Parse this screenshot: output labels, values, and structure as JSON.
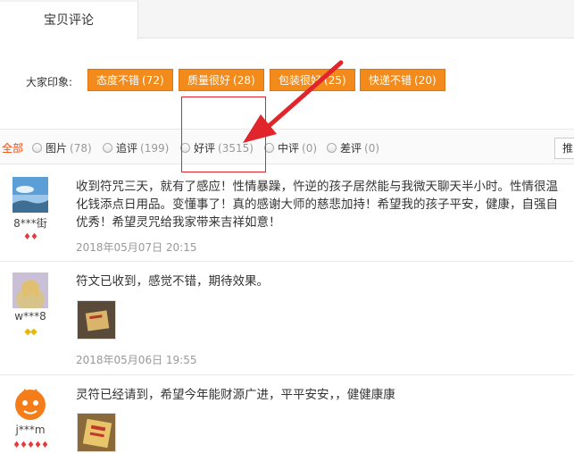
{
  "tabs": {
    "active_label": "宝贝评论"
  },
  "impressions": {
    "label": "大家印象:",
    "tags": [
      {
        "text": "态度不错",
        "count": "(72)"
      },
      {
        "text": "质量很好",
        "count": "(28)"
      },
      {
        "text": "包装很好",
        "count": "(25)"
      },
      {
        "text": "快递不错",
        "count": "(20)"
      }
    ]
  },
  "filters": {
    "all": "全部",
    "items": [
      {
        "label": "图片",
        "count": "(78)"
      },
      {
        "label": "追评",
        "count": "(199)"
      },
      {
        "label": "好评",
        "count": "(3515)"
      },
      {
        "label": "中评",
        "count": "(0)"
      },
      {
        "label": "差评",
        "count": "(0)"
      }
    ],
    "sort_label": "推"
  },
  "reviews": [
    {
      "user": "8***街",
      "lines": [
        "收到符咒三天，就有了感应！性情暴躁，忤逆的孩子居然能与我微天聊天半小时。性情很温",
        "化钱添点日用品。变懂事了！真的感谢大师的慈悲加持！希望我的孩子平安，健康，自强自",
        "优秀！希望灵咒给我家带来吉祥如意！"
      ],
      "date": "2018年05月07日 20:15",
      "badge": "♦♦"
    },
    {
      "user": "w***8",
      "lines": [
        "符文已收到，感觉不错，期待效果。"
      ],
      "date": "2018年05月06日 19:55",
      "badge": "◆◆"
    },
    {
      "user": "j***m",
      "lines": [
        "灵符已经请到，希望今年能财源广进，平平安安，，健健康康"
      ],
      "date": "",
      "badge": "♦♦♦♦♦"
    }
  ],
  "colors": {
    "tag_bg": "#f28b1c",
    "highlight": "#e0262c",
    "accent_all": "#ff4400"
  }
}
